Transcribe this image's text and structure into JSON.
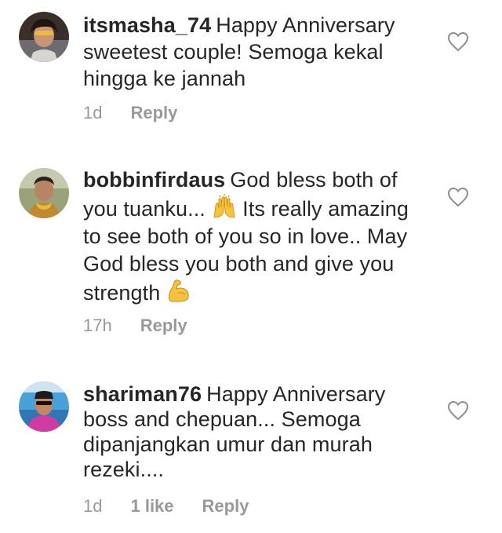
{
  "comments": [
    {
      "username": "itsmasha_74",
      "text": "Happy Anniversary sweetest couple! Semoga kekal hingga ke jannah",
      "time": "1d",
      "reply": "Reply"
    },
    {
      "username": "bobbinfirdaus",
      "text_part1": "God bless both of you tuanku...",
      "text_part2": "Its really amazing to see both of you so in love.. May God bless you both and give you strength",
      "time": "17h",
      "reply": "Reply",
      "emoji_1": "raising-hands-emoji",
      "emoji_2": "flexed-biceps-emoji"
    },
    {
      "username": "shariman76",
      "text": "Happy Anniversary boss and chepuan... Semoga dipanjangkan umur dan murah rezeki....",
      "time": "1d",
      "likes": "1 like",
      "reply": "Reply"
    }
  ],
  "icons": {
    "like": "heart-outline-icon"
  },
  "colors": {
    "text": "#262626",
    "meta": "#999999",
    "heart": "#8e8e8e"
  }
}
